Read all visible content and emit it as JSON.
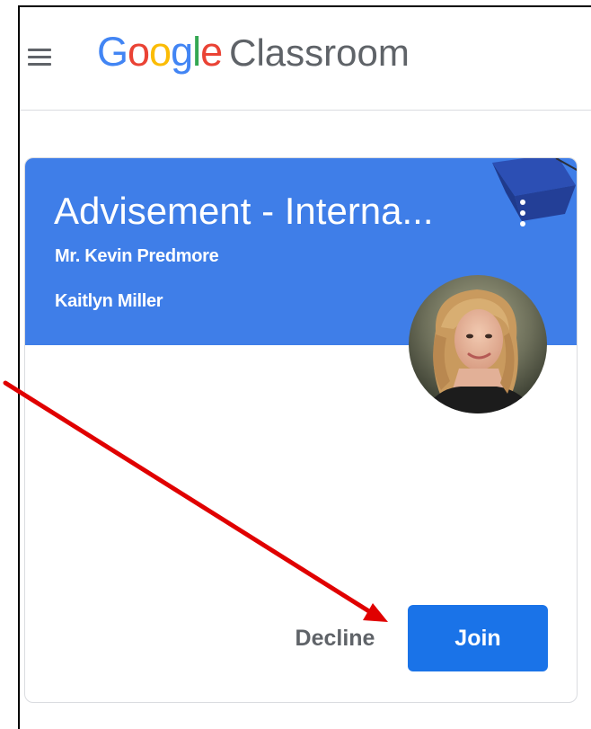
{
  "app": {
    "logo_letters": [
      "G",
      "o",
      "o",
      "g",
      "l",
      "e"
    ],
    "product_name": "Classroom"
  },
  "class_card": {
    "title": "Advisement - Interna...",
    "teacher": "Mr. Kevin Predmore",
    "student": "Kaitlyn Miller",
    "decline_label": "Decline",
    "join_label": "Join"
  },
  "colors": {
    "header_blue": "#3f7ee8",
    "join_blue": "#1a73e8",
    "annotation_arrow": "#e00000"
  },
  "icons": {
    "menu": "hamburger-menu-icon",
    "more": "more-vertical-icon",
    "decoration": "graduation-cap-icon"
  }
}
